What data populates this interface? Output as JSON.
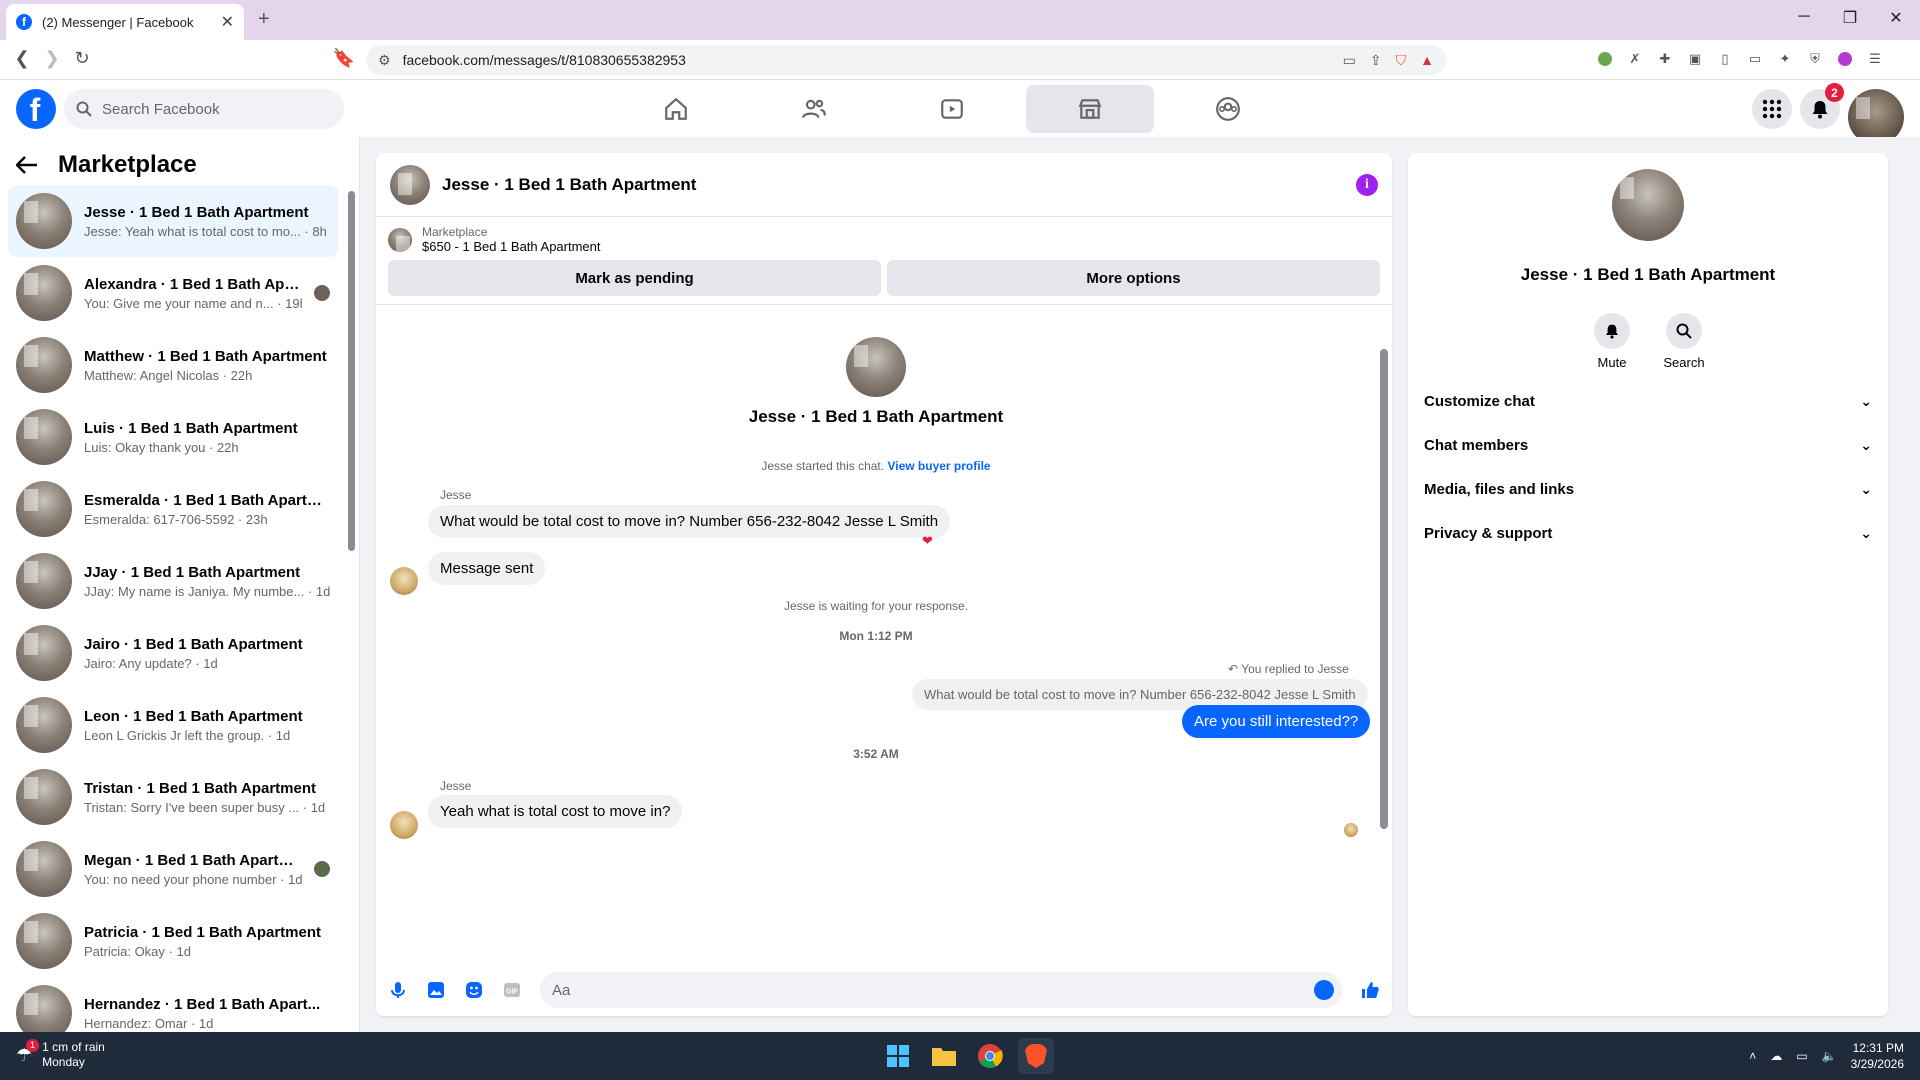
{
  "browser": {
    "tab_title": "(2) Messenger | Facebook",
    "url": "facebook.com/messages/t/810830655382953"
  },
  "fb": {
    "logo": "f",
    "search_placeholder": "Search Facebook",
    "notifications_count": "2",
    "nav_icons": [
      "home-icon",
      "friends-icon",
      "video-icon",
      "marketplace-icon",
      "groups-icon"
    ]
  },
  "left": {
    "title": "Marketplace",
    "chats": [
      {
        "name": "Jesse · 1 Bed 1 Bath Apartment",
        "preview": "Jesse: Yeah what is total cost to mo... · 8h"
      },
      {
        "name": "Alexandra · 1 Bed 1 Bath Apart...",
        "preview": "You: Give me your name and n... · 19h"
      },
      {
        "name": "Matthew · 1 Bed 1 Bath Apartment",
        "preview": "Matthew: Angel Nicolas · 22h"
      },
      {
        "name": "Luis · 1 Bed 1 Bath Apartment",
        "preview": "Luis: Okay thank you · 22h"
      },
      {
        "name": "Esmeralda · 1 Bed 1 Bath Apartm...",
        "preview": "Esmeralda: 617-706-5592 · 23h"
      },
      {
        "name": "JJay · 1 Bed 1 Bath Apartment",
        "preview": "JJay: My name is Janiya. My numbe... · 1d"
      },
      {
        "name": "Jairo · 1 Bed 1 Bath Apartment",
        "preview": "Jairo: Any update? · 1d"
      },
      {
        "name": "Leon · 1 Bed 1 Bath Apartment",
        "preview": "Leon L Grickis Jr left the group. · 1d"
      },
      {
        "name": "Tristan · 1 Bed 1 Bath Apartment",
        "preview": "Tristan: Sorry I've been super busy ... · 1d"
      },
      {
        "name": "Megan · 1 Bed 1 Bath Apartme...",
        "preview": "You: no need your phone number · 1d"
      },
      {
        "name": "Patricia · 1 Bed 1 Bath Apartment",
        "preview": "Patricia: Okay · 1d"
      },
      {
        "name": "Hernandez · 1 Bed 1 Bath Apart...",
        "preview": "Hernandez: Omar · 1d"
      }
    ]
  },
  "convo": {
    "title": "Jesse · 1 Bed 1 Bath Apartment",
    "listing_source": "Marketplace",
    "listing_price": "$650 - 1 Bed 1 Bath Apartment",
    "mark_pending": "Mark as pending",
    "more_options": "More options",
    "profile_name": "Jesse · 1 Bed 1 Bath Apartment",
    "started_text": "Jesse started this chat.",
    "view_buyer": "View buyer profile",
    "sender1": "Jesse",
    "msg1": "What would be total cost to move in?  Number 656-232-8042 Jesse L Smith",
    "msg2": "Message sent",
    "waiting": "Jesse is waiting for your response.",
    "time1": "Mon 1:12 PM",
    "replied_to": "You replied to Jesse",
    "quoted": "What would be total cost to move in?  Number 656-232-8042 Jesse L Smith",
    "my_msg": "Are you still interested??",
    "time2": "3:52 AM",
    "sender2": "Jesse",
    "msg3": "Yeah what is total cost to move in?",
    "composer_placeholder": "Aa"
  },
  "details": {
    "name": "Jesse · 1 Bed 1 Bath Apartment",
    "mute": "Mute",
    "search": "Search",
    "sections": [
      "Customize chat",
      "Chat members",
      "Media, files and links",
      "Privacy & support"
    ]
  },
  "taskbar": {
    "weather_badge": "1",
    "weather": "1 cm of rain",
    "day": "Monday",
    "time": "12:31 PM",
    "date": "3/29/2026"
  }
}
